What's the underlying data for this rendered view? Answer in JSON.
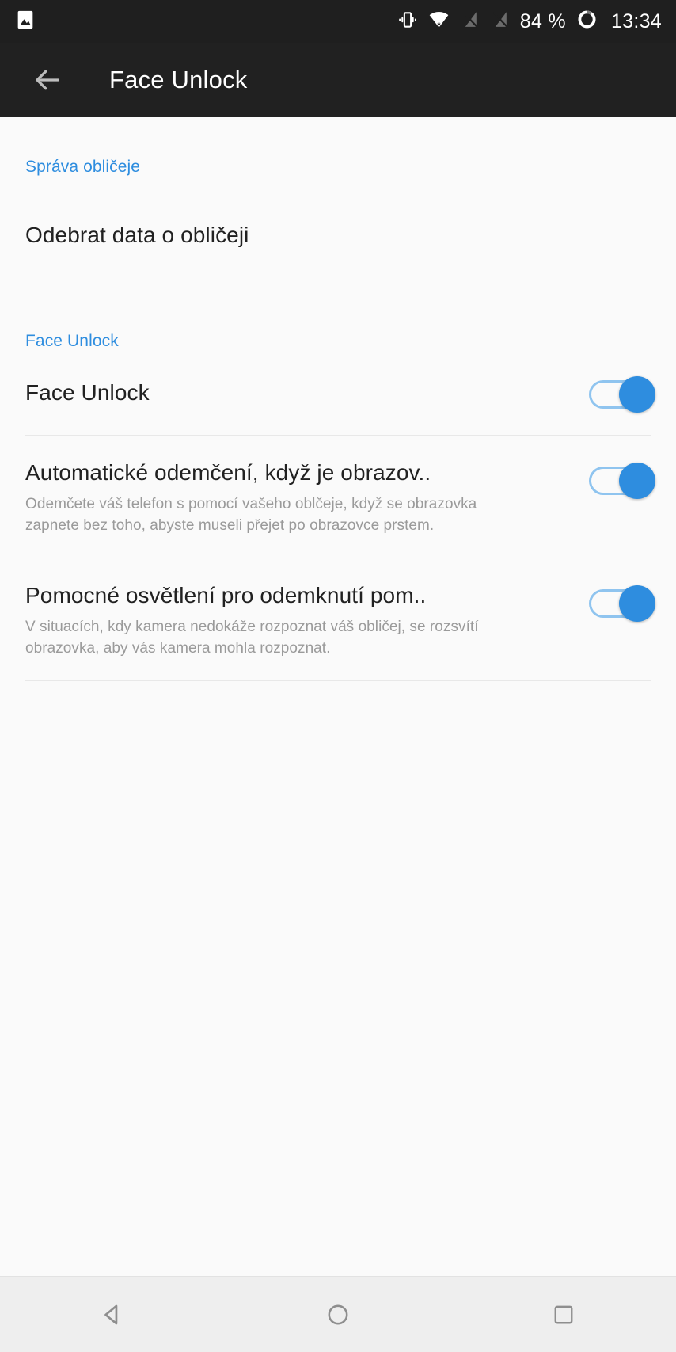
{
  "status_bar": {
    "left_icons": [
      {
        "name": "image-notification-icon",
        "label": "image"
      }
    ],
    "right_icons": [
      {
        "name": "vibrate-icon",
        "label": "vibrate"
      },
      {
        "name": "wifi-icon",
        "label": "wifi"
      },
      {
        "name": "no-sim-1-icon",
        "label": "no signal sim 1"
      },
      {
        "name": "no-sim-2-icon",
        "label": "no signal sim 2"
      }
    ],
    "battery_percent": "84 %",
    "battery_icon": "battery-circle-icon",
    "clock": "13:34",
    "background": "#1f1f1f"
  },
  "app_bar": {
    "back_icon": "back-arrow-icon",
    "title": "Face Unlock",
    "background": "#212121"
  },
  "accent_color": "#2e8ddf",
  "sections": [
    {
      "header": "Správa obličeje",
      "rows": [
        {
          "type": "simple",
          "title": "Odebrat data o obličeji"
        }
      ]
    },
    {
      "header": "Face Unlock",
      "rows": [
        {
          "type": "switch",
          "title": "Face Unlock",
          "subtitle": "",
          "checked": true,
          "state_label": "on"
        },
        {
          "type": "switch",
          "title": "Automatické odemčení, když je obrazov..",
          "subtitle": "Odemčete váš telefon s pomocí vašeho oblčeje, když se obrazovka zapnete bez toho, abyste museli přejet po obrazovce prstem.",
          "checked": true,
          "state_label": "on"
        },
        {
          "type": "switch",
          "title": "Pomocné osvětlení pro odemknutí pom..",
          "subtitle": "V situacích, kdy kamera nedokáže rozpoznat váš obličej, se rozsvítí obrazovka, aby vás kamera mohla rozpoznat.",
          "checked": true,
          "state_label": "on"
        }
      ]
    }
  ],
  "nav_bar": {
    "buttons": [
      {
        "name": "nav-back-button",
        "label": "back"
      },
      {
        "name": "nav-home-button",
        "label": "home"
      },
      {
        "name": "nav-recents-button",
        "label": "recents"
      }
    ],
    "background": "#eeeeee"
  }
}
